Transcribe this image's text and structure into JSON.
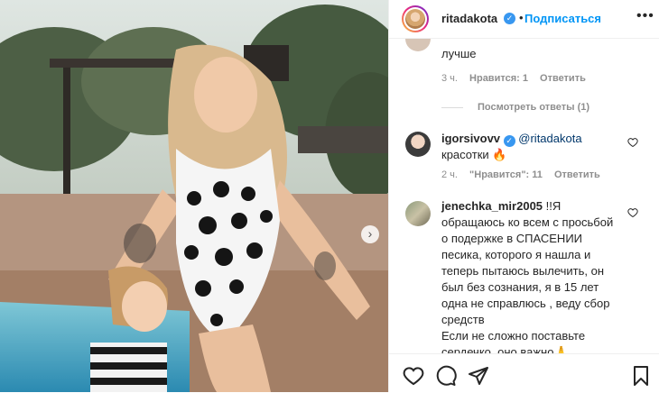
{
  "post": {
    "username": "ritadakota",
    "verified_mark": "✓",
    "separator": "•",
    "follow_label": "Подписаться",
    "more_label": "•••",
    "next_arrow": "›"
  },
  "comments": [
    {
      "text": "лучше",
      "time": "3 ч.",
      "likes": "Нравится: 1",
      "reply": "Ответить",
      "view_replies": "Посмотреть ответы (1)"
    },
    {
      "username": "igorsivovv",
      "verified_mark": "✓",
      "mention": "@ritadakota",
      "text": "красотки 🔥",
      "time": "2 ч.",
      "likes": "\"Нравится\": 11",
      "reply": "Ответить"
    },
    {
      "username": "jenechka_mir2005",
      "lines": [
        "!!Я",
        "обращаюсь ко всем с просьбой",
        "о подержке в СПАСЕНИИ",
        "песика, которого я нашла и",
        "теперь пытаюсь вылечить, он",
        "был без сознания, я в 15 лет",
        "одна не справлюсь , веду сбор",
        "средств",
        "Если не сложно поставьте",
        "сердечко, оно важно🙏"
      ]
    }
  ],
  "icons": {
    "like": "heart-icon",
    "comment": "comment-icon",
    "share": "share-icon",
    "save": "bookmark-icon"
  },
  "colors": {
    "follow": "#0095f6",
    "verified": "#3897f0",
    "muted": "#8e8e8e"
  }
}
